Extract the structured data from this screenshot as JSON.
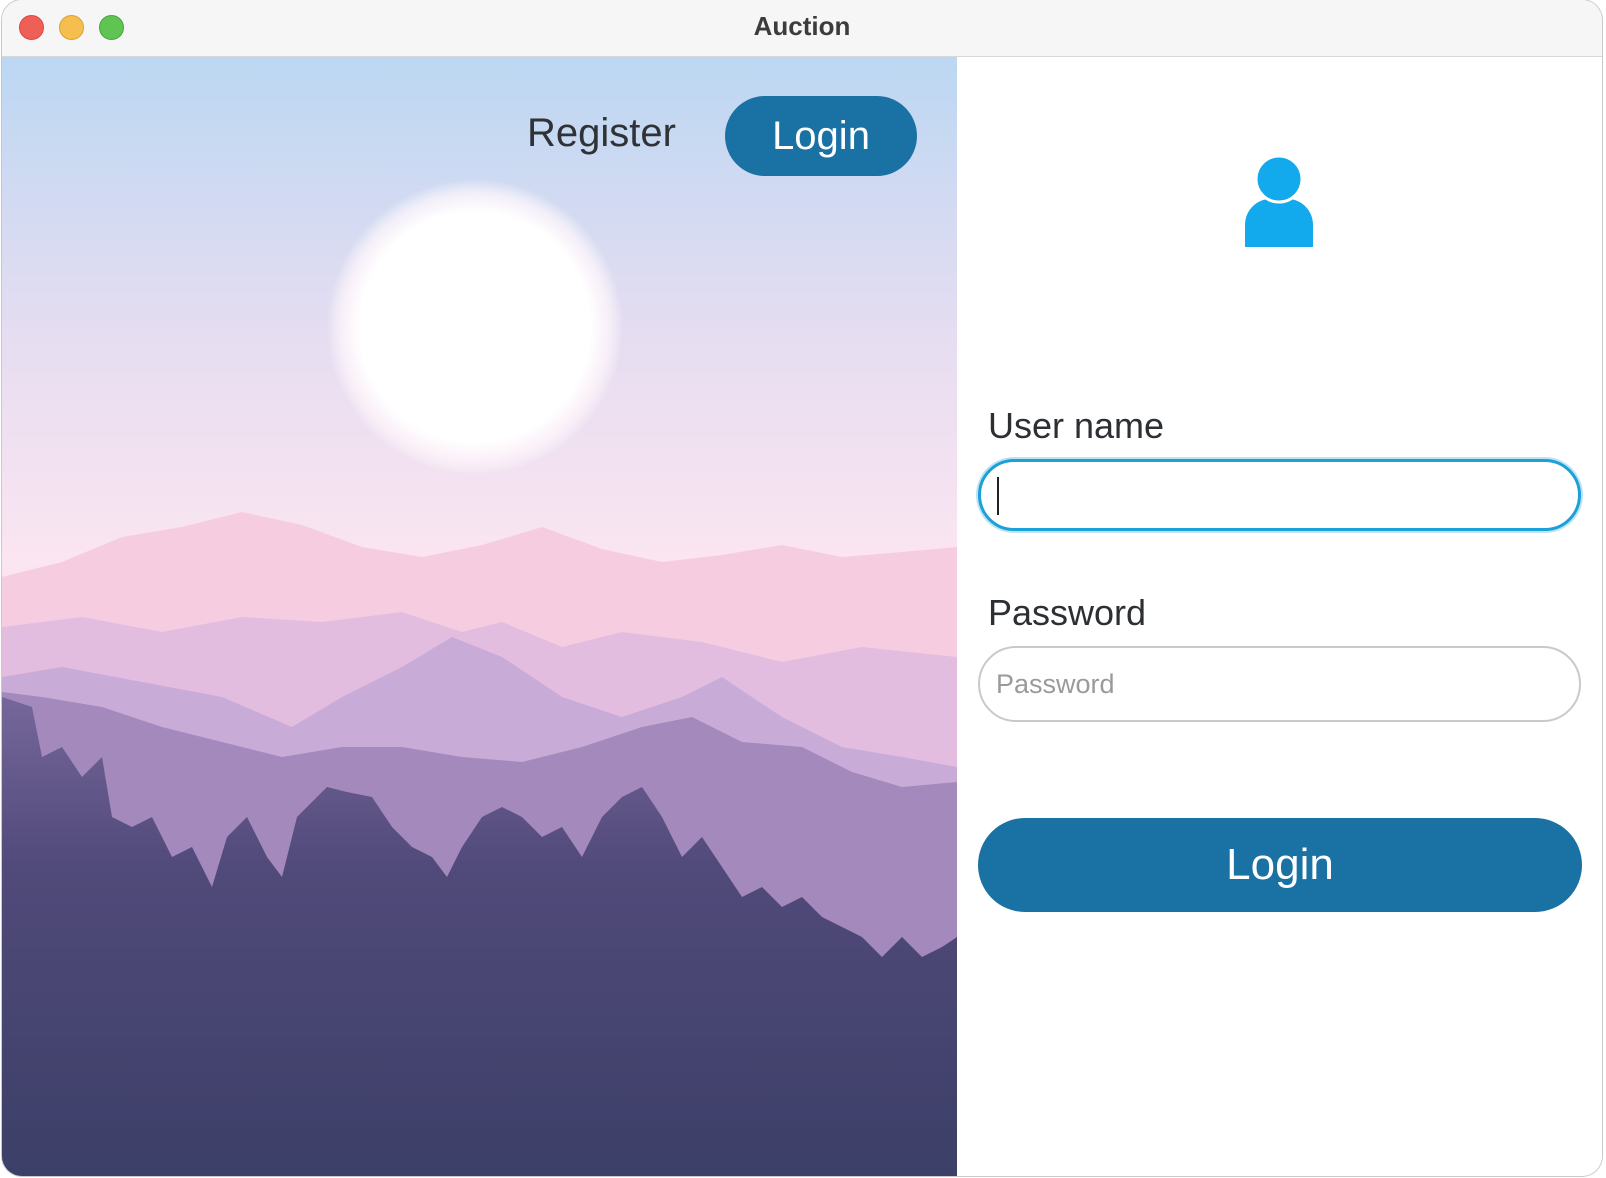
{
  "window": {
    "title": "Auction"
  },
  "nav": {
    "register_label": "Register",
    "login_label": "Login"
  },
  "form": {
    "username": {
      "label": "User name",
      "value": "",
      "placeholder": ""
    },
    "password": {
      "label": "Password",
      "value": "",
      "placeholder": "Password"
    },
    "submit_label": "Login"
  },
  "icons": {
    "user": "user-icon",
    "close": "close-window-icon",
    "minimize": "minimize-window-icon",
    "maximize": "maximize-window-icon"
  },
  "colors": {
    "accent": "#1a71a3",
    "focus_ring": "#1ba1d9",
    "user_icon": "#12aaec",
    "traffic_close": "#ee5f57",
    "traffic_min": "#f5be4f",
    "traffic_max": "#5fc453"
  }
}
